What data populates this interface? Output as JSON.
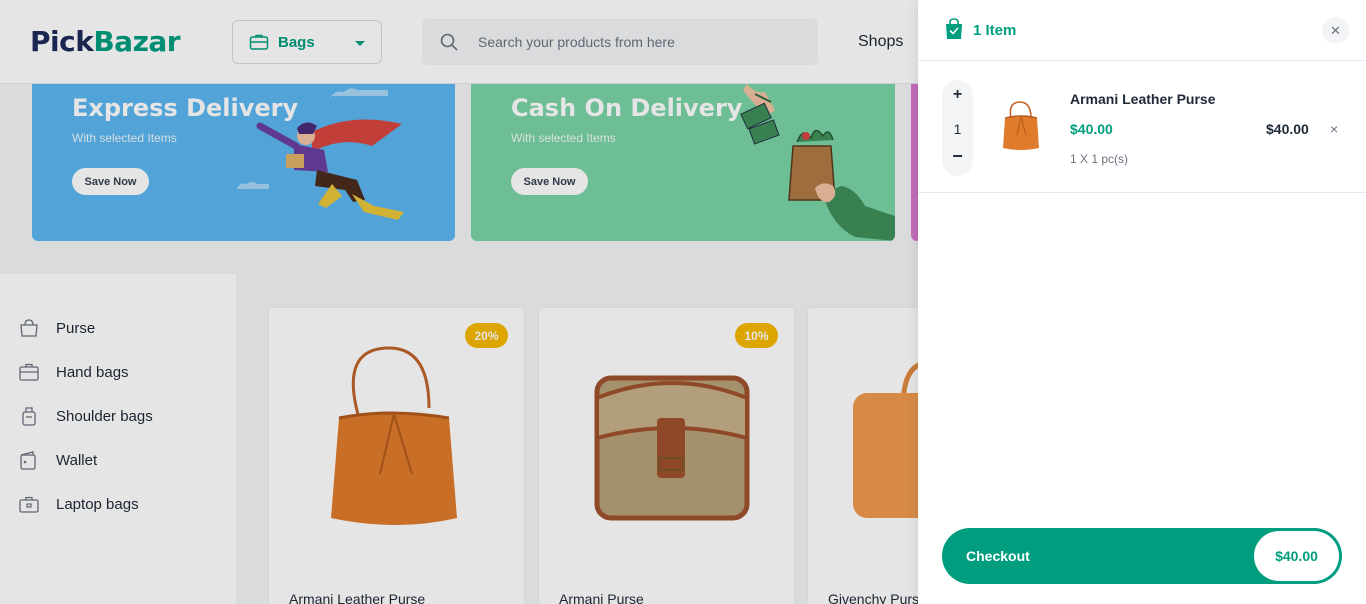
{
  "header": {
    "logo_part1": "Pick",
    "logo_part2": "Bazar",
    "type_selector": {
      "label": "Bags",
      "icon": "briefcase-icon"
    },
    "search": {
      "placeholder": "Search your products from here",
      "icon": "search-icon"
    },
    "nav": {
      "shops": "Shops"
    }
  },
  "banners": [
    {
      "title": "Express Delivery",
      "subtitle": "With selected Items",
      "button": "Save Now"
    },
    {
      "title": "Cash On Delivery",
      "subtitle": "With selected Items",
      "button": "Save Now"
    }
  ],
  "sidebar": {
    "categories": [
      {
        "label": "Purse",
        "icon": "purse-icon"
      },
      {
        "label": "Hand bags",
        "icon": "handbag-icon"
      },
      {
        "label": "Shoulder bags",
        "icon": "shoulder-bag-icon"
      },
      {
        "label": "Wallet",
        "icon": "wallet-icon"
      },
      {
        "label": "Laptop bags",
        "icon": "laptop-bag-icon"
      }
    ]
  },
  "products": [
    {
      "name": "Armani Leather Purse",
      "discount": "20%"
    },
    {
      "name": "Armani Purse",
      "discount": "10%"
    },
    {
      "name": "Givenchy Purse",
      "discount": ""
    }
  ],
  "cart": {
    "count_label": "1 Item",
    "close_icon": "close-icon",
    "items": [
      {
        "name": "Armani Leather Purse",
        "price": "$40.00",
        "quantity": "1",
        "qty_detail": "1 X 1 pc(s)",
        "total": "$40.00",
        "increment": "+",
        "decrement": "−",
        "remove": "×"
      }
    ],
    "checkout": {
      "label": "Checkout",
      "total": "$40.00"
    }
  },
  "colors": {
    "accent": "#009e7f",
    "brand_dark": "#1e2a5a",
    "discount_badge": "#f5b800",
    "banner_blue": "#5cb6f0",
    "banner_green": "#7ad3a6"
  }
}
